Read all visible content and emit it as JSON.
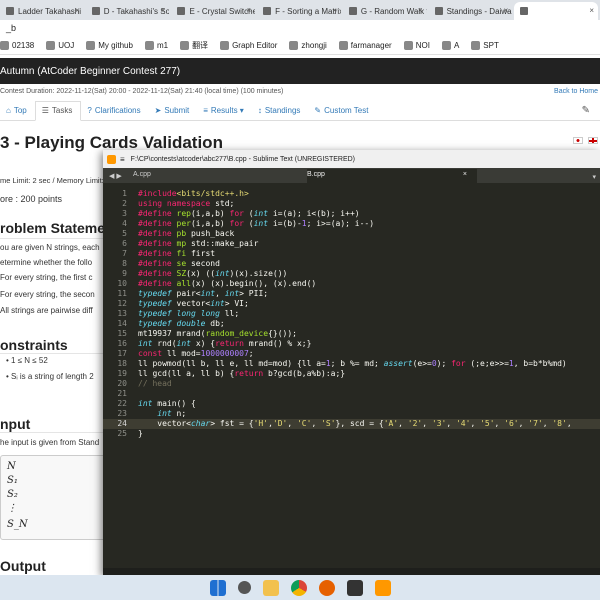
{
  "browser": {
    "tabs": [
      {
        "label": "Ladder Takahashi",
        "active": false
      },
      {
        "label": "D - Takahashi's Solit",
        "active": false
      },
      {
        "label": "E - Crystal Switches",
        "active": false
      },
      {
        "label": "F - Sorting a Matrix",
        "active": false
      },
      {
        "label": "G - Random Walk to",
        "active": false
      },
      {
        "label": "Standings - Daiwa S",
        "active": false
      },
      {
        "label": "",
        "active": true
      }
    ],
    "url_fragment": "_b",
    "bookmarks": [
      "02138",
      "UOJ",
      "My github",
      "m1",
      "翻译",
      "Graph Editor",
      "zhongji",
      "farmanager",
      "NOI",
      "A",
      "SPT"
    ]
  },
  "atcoder": {
    "contest_title": "Autumn (AtCoder Beginner Contest 277)",
    "duration": "Contest Duration: 2022-11-12(Sat) 20:00 - 2022-11-12(Sat) 21:40 (local time) (100 minutes)",
    "back_link": "Back to Home",
    "nav": [
      {
        "icon": "⌂",
        "label": "Top",
        "active": false
      },
      {
        "icon": "☰",
        "label": "Tasks",
        "active": true
      },
      {
        "icon": "?",
        "label": "Clarifications",
        "active": false
      },
      {
        "icon": "➤",
        "label": "Submit",
        "active": false
      },
      {
        "icon": "≡",
        "label": "Results ▾",
        "active": false
      },
      {
        "icon": "↕",
        "label": "Standings",
        "active": false
      },
      {
        "icon": "✎",
        "label": "Custom Test",
        "active": false
      }
    ],
    "problem_title": "3 - Playing Cards Validation",
    "limits": "me Limit: 2 sec / Memory Limit:",
    "score": "ore : 200 points",
    "statement_heading": "roblem Statemen",
    "statement_lines": [
      "ou are given N strings, each",
      "etermine whether the follo"
    ],
    "conditions": [
      "For every string, the first c",
      "For every string, the secon",
      "All strings are pairwise diff"
    ],
    "constraints_heading": "onstraints",
    "constraints": [
      "• 1 ≤ N ≤ 52",
      "• Sᵢ is a string of length 2"
    ],
    "input_heading": "nput",
    "input_text": "he input is given from Stand",
    "input_format": [
      "N",
      "S₁",
      "S₂",
      "⋮",
      "S_N"
    ],
    "output_heading": "Output"
  },
  "sublime": {
    "title": "F:\\CP\\contests\\atcoder\\abc277\\B.cpp - Sublime Text (UNREGISTERED)",
    "tabs": [
      "A.cpp",
      "B.cpp"
    ],
    "active_tab": 1,
    "current_line": 24,
    "lines": [
      [
        {
          "t": "#include",
          "c": "k"
        },
        {
          "t": "<bits/stdc++.h>",
          "c": "s"
        }
      ],
      [
        {
          "t": "using namespace",
          "c": "k"
        },
        {
          "t": " std;",
          "c": ""
        }
      ],
      [
        {
          "t": "#define",
          "c": "k"
        },
        {
          "t": " rep",
          "c": "f"
        },
        {
          "t": "(i,a,b) ",
          "c": ""
        },
        {
          "t": "for",
          "c": "k"
        },
        {
          "t": " (",
          "c": ""
        },
        {
          "t": "int",
          "c": "t"
        },
        {
          "t": " i=(a); i<(b); i++)",
          "c": ""
        }
      ],
      [
        {
          "t": "#define",
          "c": "k"
        },
        {
          "t": " per",
          "c": "f"
        },
        {
          "t": "(i,a,b) ",
          "c": ""
        },
        {
          "t": "for",
          "c": "k"
        },
        {
          "t": " (",
          "c": ""
        },
        {
          "t": "int",
          "c": "t"
        },
        {
          "t": " i=(b)-",
          "c": ""
        },
        {
          "t": "1",
          "c": "n"
        },
        {
          "t": "; i>=(a); i--)",
          "c": ""
        }
      ],
      [
        {
          "t": "#define",
          "c": "k"
        },
        {
          "t": " pb",
          "c": "f"
        },
        {
          "t": " push_back",
          "c": ""
        }
      ],
      [
        {
          "t": "#define",
          "c": "k"
        },
        {
          "t": " mp",
          "c": "f"
        },
        {
          "t": " std::make_pair",
          "c": ""
        }
      ],
      [
        {
          "t": "#define",
          "c": "k"
        },
        {
          "t": " fi",
          "c": "f"
        },
        {
          "t": " first",
          "c": ""
        }
      ],
      [
        {
          "t": "#define",
          "c": "k"
        },
        {
          "t": " se",
          "c": "f"
        },
        {
          "t": " second",
          "c": ""
        }
      ],
      [
        {
          "t": "#define",
          "c": "k"
        },
        {
          "t": " SZ",
          "c": "f"
        },
        {
          "t": "(x) ((",
          "c": ""
        },
        {
          "t": "int",
          "c": "t"
        },
        {
          "t": ")(x).size())",
          "c": ""
        }
      ],
      [
        {
          "t": "#define",
          "c": "k"
        },
        {
          "t": " all",
          "c": "f"
        },
        {
          "t": "(x) (x).begin(), (x).end()",
          "c": ""
        }
      ],
      [
        {
          "t": "typedef",
          "c": "t"
        },
        {
          "t": " pair<",
          "c": ""
        },
        {
          "t": "int",
          "c": "t"
        },
        {
          "t": ", ",
          "c": ""
        },
        {
          "t": "int",
          "c": "t"
        },
        {
          "t": "> PII;",
          "c": ""
        }
      ],
      [
        {
          "t": "typedef",
          "c": "t"
        },
        {
          "t": " vector<",
          "c": ""
        },
        {
          "t": "int",
          "c": "t"
        },
        {
          "t": "> VI;",
          "c": ""
        }
      ],
      [
        {
          "t": "typedef",
          "c": "t"
        },
        {
          "t": " ",
          "c": ""
        },
        {
          "t": "long long",
          "c": "t"
        },
        {
          "t": " ll;",
          "c": ""
        }
      ],
      [
        {
          "t": "typedef",
          "c": "t"
        },
        {
          "t": " ",
          "c": ""
        },
        {
          "t": "double",
          "c": "t"
        },
        {
          "t": " db;",
          "c": ""
        }
      ],
      [
        {
          "t": "mt19937 mrand(",
          "c": ""
        },
        {
          "t": "random_device",
          "c": "f"
        },
        {
          "t": "{}());",
          "c": ""
        }
      ],
      [
        {
          "t": "int",
          "c": "t"
        },
        {
          "t": " rnd(",
          "c": ""
        },
        {
          "t": "int",
          "c": "t"
        },
        {
          "t": " x) {",
          "c": ""
        },
        {
          "t": "return",
          "c": "k"
        },
        {
          "t": " mrand() % x;}",
          "c": ""
        }
      ],
      [
        {
          "t": "const",
          "c": "k"
        },
        {
          "t": " ll mod=",
          "c": ""
        },
        {
          "t": "1000000007",
          "c": "n"
        },
        {
          "t": ";",
          "c": ""
        }
      ],
      [
        {
          "t": "ll powmod(ll b, ll e, ll md=mod) {ll a=",
          "c": ""
        },
        {
          "t": "1",
          "c": "n"
        },
        {
          "t": "; b %= md; ",
          "c": ""
        },
        {
          "t": "assert",
          "c": "t"
        },
        {
          "t": "(e>=",
          "c": ""
        },
        {
          "t": "0",
          "c": "n"
        },
        {
          "t": "); ",
          "c": ""
        },
        {
          "t": "for",
          "c": "k"
        },
        {
          "t": " (;e;e>>=",
          "c": ""
        },
        {
          "t": "1",
          "c": "n"
        },
        {
          "t": ", b=b*b%md)",
          "c": ""
        }
      ],
      [
        {
          "t": "ll gcd(ll a, ll b) {",
          "c": ""
        },
        {
          "t": "return",
          "c": "k"
        },
        {
          "t": " b?gcd(b,a%b):a;}",
          "c": ""
        }
      ],
      [
        {
          "t": "// head",
          "c": "c"
        }
      ],
      [],
      [
        {
          "t": "int",
          "c": "t"
        },
        {
          "t": " main() {",
          "c": ""
        }
      ],
      [
        {
          "t": "    ",
          "c": ""
        },
        {
          "t": "int",
          "c": "t"
        },
        {
          "t": " n;",
          "c": ""
        }
      ],
      [
        {
          "t": "    vector<",
          "c": ""
        },
        {
          "t": "char",
          "c": "t"
        },
        {
          "t": "> fst = {",
          "c": ""
        },
        {
          "t": "'H'",
          "c": "s"
        },
        {
          "t": ",",
          "c": ""
        },
        {
          "t": "'D'",
          "c": "s"
        },
        {
          "t": ", ",
          "c": ""
        },
        {
          "t": "'C'",
          "c": "s"
        },
        {
          "t": ", ",
          "c": ""
        },
        {
          "t": "'S'",
          "c": "s"
        },
        {
          "t": "}, scd = {",
          "c": ""
        },
        {
          "t": "'A'",
          "c": "s"
        },
        {
          "t": ", ",
          "c": ""
        },
        {
          "t": "'2'",
          "c": "s"
        },
        {
          "t": ", ",
          "c": ""
        },
        {
          "t": "'3'",
          "c": "s"
        },
        {
          "t": ", ",
          "c": ""
        },
        {
          "t": "'4'",
          "c": "s"
        },
        {
          "t": ", ",
          "c": ""
        },
        {
          "t": "'5'",
          "c": "s"
        },
        {
          "t": ", ",
          "c": ""
        },
        {
          "t": "'6'",
          "c": "s"
        },
        {
          "t": ", ",
          "c": ""
        },
        {
          "t": "'7'",
          "c": "s"
        },
        {
          "t": ", ",
          "c": ""
        },
        {
          "t": "'8'",
          "c": "s"
        },
        {
          "t": ",",
          "c": ""
        }
      ],
      [
        {
          "t": "}",
          "c": ""
        }
      ]
    ]
  },
  "taskbar": {
    "icons": [
      "windows-start-icon",
      "search-icon",
      "file-explorer-icon",
      "chrome-icon",
      "firefox-icon",
      "terminal-icon",
      "sublime-text-icon"
    ]
  }
}
